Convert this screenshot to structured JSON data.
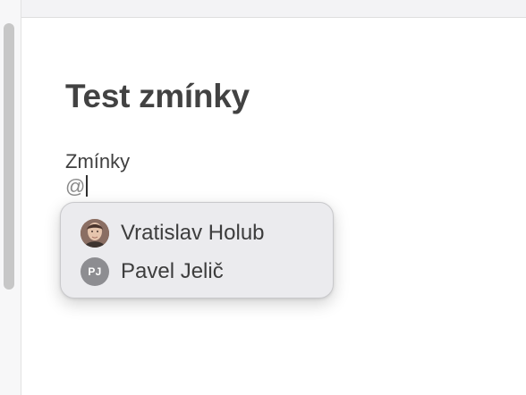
{
  "document": {
    "title": "Test zmínky",
    "line1": "Zmínky",
    "mention_prefix": "@"
  },
  "mention_popup": {
    "suggestions": [
      {
        "name": "Vratislav Holub",
        "avatar_type": "photo",
        "avatar_initials": ""
      },
      {
        "name": "Pavel Jelič",
        "avatar_type": "initials",
        "avatar_initials": "PJ"
      }
    ]
  },
  "colors": {
    "background": "#ffffff",
    "popup_background": "#ebebee",
    "title_text": "#424242",
    "body_text": "#3f3f3f",
    "initials_avatar": "#8d8d91",
    "scrollbar_thumb": "#c7c7c7"
  }
}
